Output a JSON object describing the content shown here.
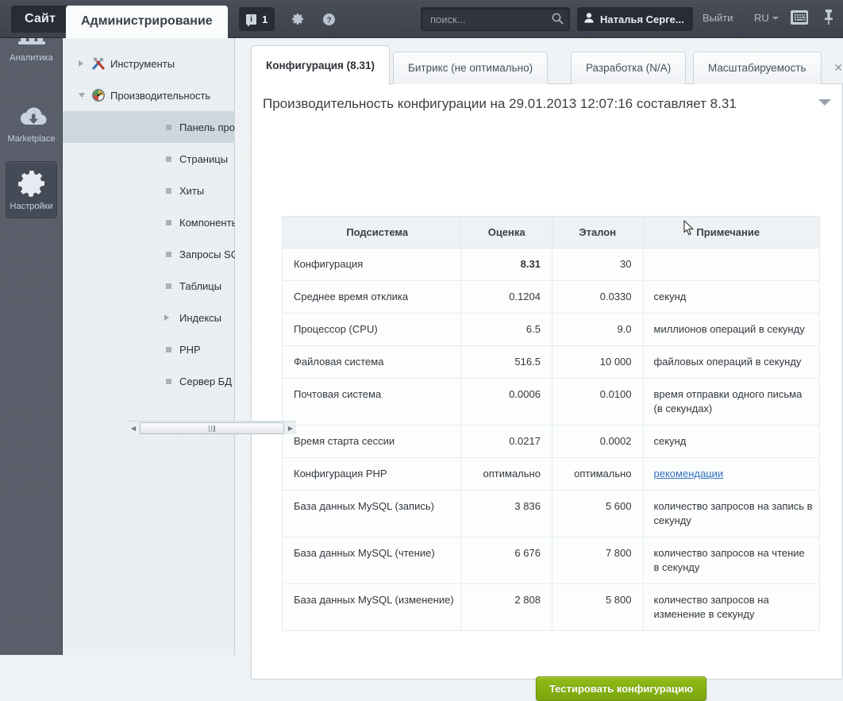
{
  "topbar": {
    "site_tab": "Сайт",
    "admin_tab": "Администрирование",
    "notification_count": "1",
    "notification_icon": "info-icon",
    "gear_icon": "gear-icon",
    "help_icon": "help-icon",
    "search": {
      "placeholder": "поиск...",
      "value": "",
      "icon": "search-icon"
    },
    "user": {
      "name": "Наталья Серге...",
      "icon": "user-icon"
    },
    "logout": "Выйти",
    "language": "RU",
    "keyboard_icon": "keyboard-icon",
    "pin_icon": "pin-icon"
  },
  "rail": {
    "items": [
      {
        "label": "Аналитика",
        "icon": "analytics-icon",
        "active": false
      },
      {
        "label": "Marketplace",
        "icon": "cloud-download-icon",
        "active": false
      },
      {
        "label": "Настройки",
        "icon": "gear-icon",
        "active": true
      }
    ]
  },
  "tree": {
    "nodes": [
      {
        "label": "Инструменты",
        "level": 1,
        "state": "collapsed",
        "icon": "tools-icon",
        "selected": false
      },
      {
        "label": "Производительность",
        "level": 1,
        "state": "expanded",
        "icon": "gauge-icon",
        "selected": false
      },
      {
        "label": "Панель производительнос",
        "level": 2,
        "state": "leaf",
        "selected": true
      },
      {
        "label": "Страницы",
        "level": 2,
        "state": "leaf",
        "selected": false
      },
      {
        "label": "Хиты",
        "level": 2,
        "state": "leaf",
        "selected": false
      },
      {
        "label": "Компоненты",
        "level": 2,
        "state": "leaf",
        "selected": false
      },
      {
        "label": "Запросы SQL",
        "level": 2,
        "state": "leaf",
        "selected": false
      },
      {
        "label": "Таблицы",
        "level": 2,
        "state": "leaf",
        "selected": false
      },
      {
        "label": "Индексы",
        "level": 2,
        "state": "collapsed",
        "selected": false
      },
      {
        "label": "PHP",
        "level": 2,
        "state": "leaf",
        "selected": false
      },
      {
        "label": "Сервер БД",
        "level": 2,
        "state": "leaf",
        "selected": false
      }
    ]
  },
  "tabs": [
    {
      "label": "Конфигурация (8.31)",
      "active": true
    },
    {
      "label": "Битрикс (не оптимально)",
      "active": false
    },
    {
      "label": "Разработка (N/A)",
      "active": false
    },
    {
      "label": "Масштабируемость",
      "active": false
    }
  ],
  "tab_close_icon": "close-icon",
  "main": {
    "title": "Производительность конфигурации на 29.01.2013 12:07:16 составляет 8.31",
    "collapse_icon": "chevron-down-icon",
    "test_button": "Тестировать конфигурацию"
  },
  "table": {
    "headers": [
      "Подсистема",
      "Оценка",
      "Эталон",
      "Примечание"
    ],
    "rows": [
      {
        "subsystem": "Конфигурация",
        "score": "8.31",
        "score_bold": true,
        "reference": "30",
        "note": ""
      },
      {
        "subsystem": "Среднее время отклика",
        "score": "0.1204",
        "score_bold": false,
        "reference": "0.0330",
        "note": "секунд"
      },
      {
        "subsystem": "Процессор (CPU)",
        "score": "6.5",
        "score_bold": false,
        "reference": "9.0",
        "note": "миллионов операций в секунду"
      },
      {
        "subsystem": "Файловая система",
        "score": "516.5",
        "score_bold": false,
        "reference": "10 000",
        "note": "файловых операций в секунду"
      },
      {
        "subsystem": "Почтовая система",
        "score": "0.0006",
        "score_bold": false,
        "reference": "0.0100",
        "note": "время отправки одного письма (в секундах)"
      },
      {
        "subsystem": "Время старта сессии",
        "score": "0.0217",
        "score_bold": false,
        "reference": "0.0002",
        "note": "секунд"
      },
      {
        "subsystem": "Конфигурация PHP",
        "score": "оптимально",
        "score_bold": false,
        "reference": "оптимально",
        "note": "рекомендации",
        "note_link": true
      },
      {
        "subsystem": "База данных MySQL (запись)",
        "score": "3 836",
        "score_bold": false,
        "reference": "5 600",
        "note": "количество запросов на запись в секунду"
      },
      {
        "subsystem": "База данных MySQL (чтение)",
        "score": "6 676",
        "score_bold": false,
        "reference": "7 800",
        "note": "количество запросов на чтение в секунду"
      },
      {
        "subsystem": "База данных MySQL (изменение)",
        "score": "2 808",
        "score_bold": false,
        "reference": "5 800",
        "note": "количество запросов на изменение в секунду"
      }
    ]
  },
  "colors": {
    "topbar": "#3d424b",
    "rail": "#585e69",
    "tree_panel": "#e4ecef",
    "accent_green": "#7ba60d",
    "link": "#2f6fbf",
    "selected_tree": "#ccd8dd"
  }
}
